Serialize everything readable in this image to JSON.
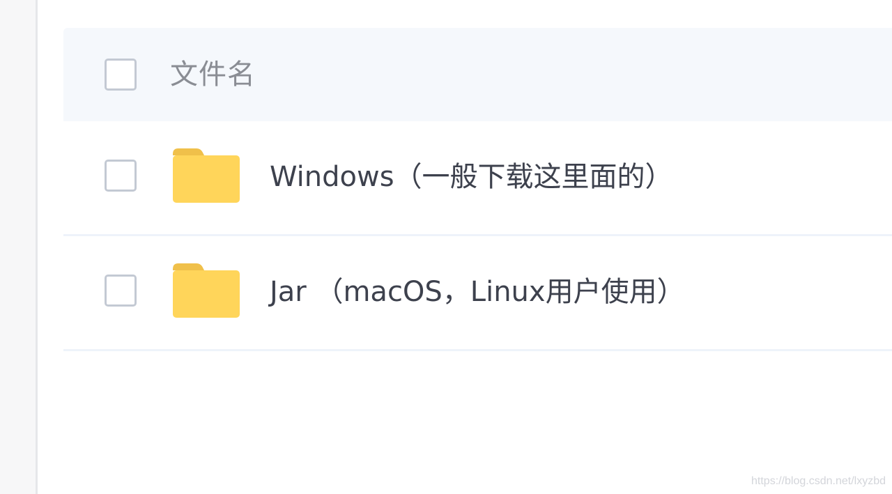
{
  "list": {
    "header": {
      "column_name": "文件名"
    },
    "rows": [
      {
        "name": "Windows（一般下载这里面的）",
        "icon": "folder-icon"
      },
      {
        "name": "Jar （macOS，Linux用户使用）",
        "icon": "folder-icon"
      }
    ]
  },
  "watermark": "https://blog.csdn.net/lxyzbd",
  "colors": {
    "folder": "#ffd55a",
    "folder_tab": "#f0c04a",
    "header_bg": "#f5f8fc",
    "text": "#3d414d",
    "header_text": "#8a8d94",
    "checkbox_border": "#c3c9d3"
  }
}
